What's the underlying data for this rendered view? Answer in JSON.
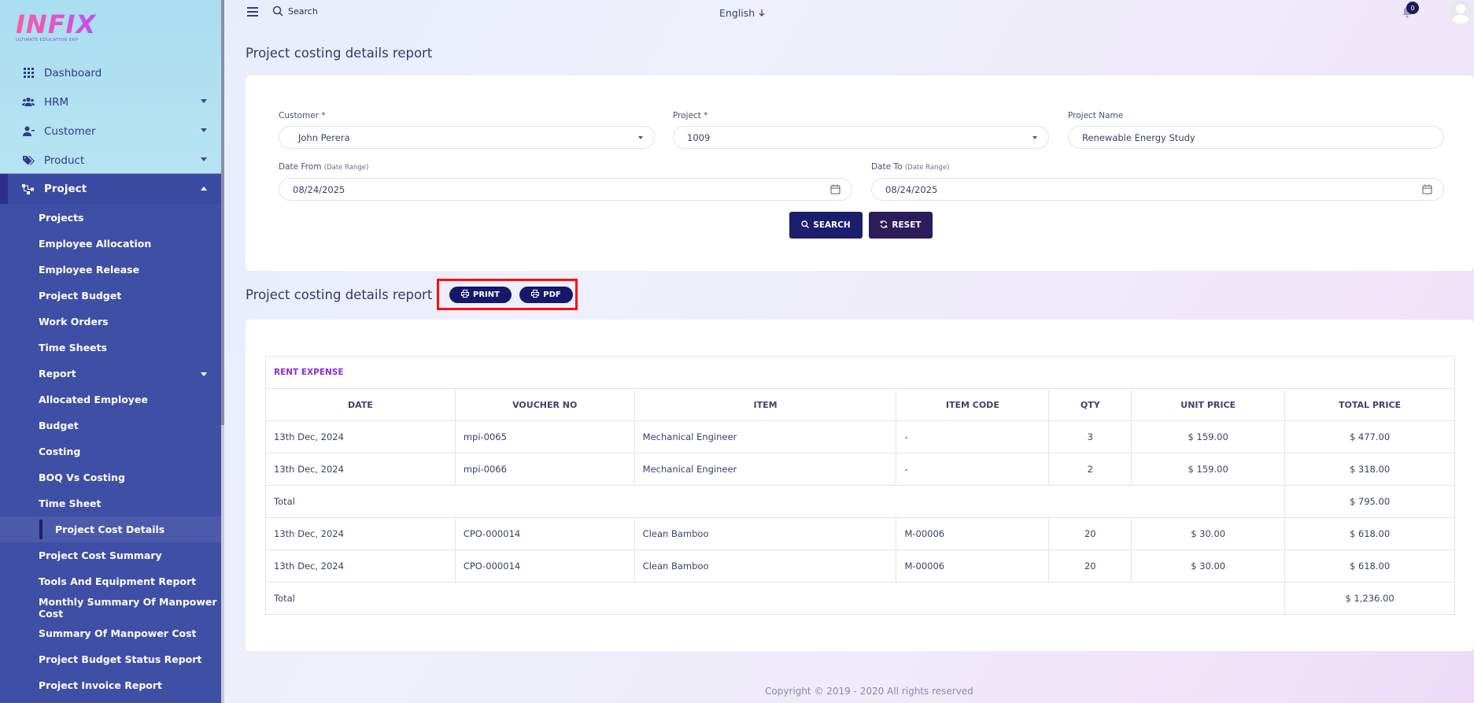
{
  "logo": {
    "mark": "INFIX",
    "sub": "ULTIMATE EDUCATION ERP"
  },
  "sidebar": {
    "top_items": [
      {
        "label": "Dashboard",
        "icon": "grid-icon"
      },
      {
        "label": "HRM",
        "icon": "users-icon"
      },
      {
        "label": "Customer",
        "icon": "user-icon"
      },
      {
        "label": "Product",
        "icon": "tag-icon"
      }
    ],
    "project": {
      "label": "Project",
      "icon": "sitemap-icon"
    },
    "sub_items": [
      "Projects",
      "Employee Allocation",
      "Employee Release",
      "Project Budget",
      "Work Orders",
      "Time Sheets",
      "Report",
      "Allocated Employee",
      "Budget",
      "Costing",
      "BOQ Vs Costing",
      "Time Sheet",
      "Project Cost Details",
      "Project Cost Summary",
      "Tools And Equipment Report",
      "Monthly Summary Of Manpower Cost",
      "Summary Of Manpower Cost",
      "Project Budget Status Report",
      "Project Invoice Report"
    ]
  },
  "topbar": {
    "search_placeholder": "Search",
    "language": "English",
    "notification_count": "0"
  },
  "page": {
    "title": "Project costing details report"
  },
  "filters": {
    "customer_label": "Customer *",
    "customer_value": "John Perera",
    "project_label": "Project *",
    "project_value": "1009",
    "project_name_label": "Project Name",
    "project_name_value": "Renewable Energy Study",
    "date_from_label": "Date From",
    "date_from_hint": "(Date Range)",
    "date_from_value": "08/24/2025",
    "date_to_label": "Date To",
    "date_to_hint": "(Date Range)",
    "date_to_value": "08/24/2025",
    "search_button": "SEARCH",
    "reset_button": "RESET"
  },
  "report": {
    "title": "Project costing details report",
    "print_button": "PRINT",
    "pdf_button": "PDF",
    "section": "RENT EXPENSE",
    "headers": [
      "DATE",
      "VOUCHER NO",
      "ITEM",
      "ITEM CODE",
      "QTY",
      "UNIT PRICE",
      "TOTAL PRICE"
    ],
    "rows": [
      [
        "13th Dec, 2024",
        "mpi-0065",
        "Mechanical Engineer",
        "-",
        "3",
        "$ 159.00",
        "$ 477.00"
      ],
      [
        "13th Dec, 2024",
        "mpi-0066",
        "Mechanical Engineer",
        "-",
        "2",
        "$ 159.00",
        "$ 318.00"
      ]
    ],
    "total1_label": "Total",
    "total1_value": "$ 795.00",
    "rows2": [
      [
        "13th Dec, 2024",
        "CPO-000014",
        "Clean Bamboo",
        "M-00006",
        "20",
        "$ 30.00",
        "$ 618.00"
      ],
      [
        "13th Dec, 2024",
        "CPO-000014",
        "Clean Bamboo",
        "M-00006",
        "20",
        "$ 30.00",
        "$ 618.00"
      ]
    ],
    "total2_label": "Total",
    "total2_value": "$ 1,236.00"
  },
  "footer": {
    "text": "Copyright © 2019 - 2020 All rights reserved"
  }
}
